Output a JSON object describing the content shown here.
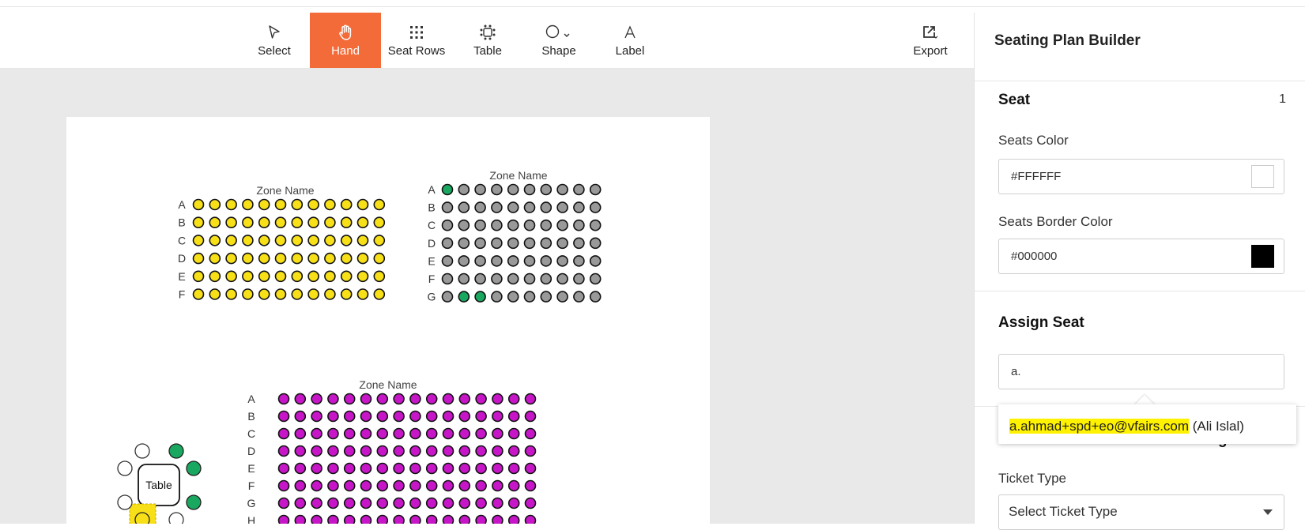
{
  "toolbar": {
    "tools": [
      {
        "label": "Select",
        "icon": "cursor-icon"
      },
      {
        "label": "Hand",
        "icon": "hand-icon",
        "active": true
      },
      {
        "label": "Seat Rows",
        "icon": "grid-dots-icon"
      },
      {
        "label": "Table",
        "icon": "table-icon"
      },
      {
        "label": "Shape",
        "icon": "circle-shape-icon"
      },
      {
        "label": "Label",
        "icon": "letter-a-icon"
      }
    ],
    "export_label": "Export"
  },
  "panel": {
    "title": "Seating Plan Builder",
    "seat_section": {
      "heading": "Seat",
      "count": "1",
      "seats_color_label": "Seats Color",
      "seats_color_value": "#FFFFFF",
      "border_color_label": "Seats Border Color",
      "border_color_value": "#000000"
    },
    "assign_section": {
      "heading": "Assign Seat",
      "input_value": "a.",
      "suggestion_email": "a.ahmad+spd+eo@vfairs.com",
      "suggestion_name": " (Ali Islal)"
    },
    "ticket_section": {
      "heading_partial": "g",
      "ticket_type_label": "Ticket Type",
      "select_placeholder": "Select Ticket Type"
    }
  },
  "canvas": {
    "zones": [
      {
        "name": "Zone Name",
        "rows": [
          "A",
          "B",
          "C",
          "D",
          "E",
          "F"
        ],
        "seats_per_row": 12,
        "fill": "#f7e017",
        "green_seats": []
      },
      {
        "name": "Zone Name",
        "rows": [
          "A",
          "B",
          "C",
          "D",
          "E",
          "F",
          "G"
        ],
        "seats_per_row": 10,
        "fill": "#999999",
        "green_seats": [
          [
            "A",
            1
          ],
          [
            "G",
            2
          ],
          [
            "G",
            3
          ]
        ]
      },
      {
        "name": "Zone Name",
        "rows": [
          "A",
          "B",
          "C",
          "D",
          "E",
          "F",
          "G",
          "H"
        ],
        "seats_per_row": 16,
        "fill": "#c716c7",
        "green_seats": []
      }
    ],
    "table": {
      "label": "Table",
      "seat_fills": [
        "#ffffff",
        "#1aa760",
        "#1aa760",
        "#1aa760",
        "#ffffff",
        "#f7e017",
        "#ffffff",
        "#ffffff"
      ]
    },
    "colors": {
      "green": "#1aa760",
      "accent": "#f26b38"
    }
  }
}
